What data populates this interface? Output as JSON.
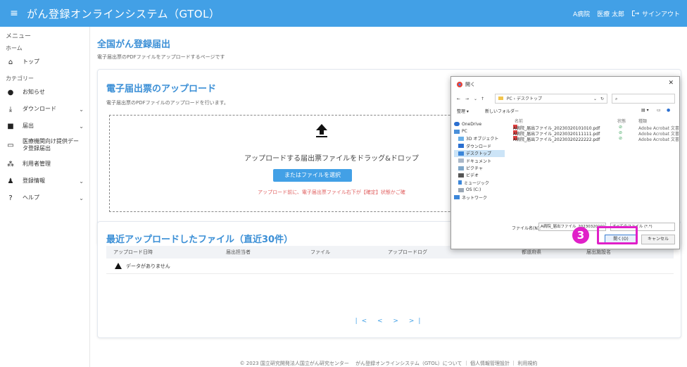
{
  "app": {
    "title": "がん登録オンラインシステム（GTOL）",
    "hospital": "A病院",
    "user": "医療 太郎",
    "signout": "サインアウト"
  },
  "sidebar": {
    "menu_label": "メニュー",
    "home_section": "ホーム",
    "top": "トップ",
    "category_section": "カテゴリー",
    "items": [
      {
        "label": "お知らせ",
        "icon": "info-icon",
        "has_chevron": false
      },
      {
        "label": "ダウンロード",
        "icon": "download-icon",
        "has_chevron": true
      },
      {
        "label": "届出",
        "icon": "file-icon",
        "has_chevron": true
      },
      {
        "label": "医療機関向け提供データ登録届出",
        "icon": "monitor-icon",
        "has_chevron": false
      },
      {
        "label": "利用者管理",
        "icon": "users-icon",
        "has_chevron": false
      },
      {
        "label": "登録情報",
        "icon": "user-settings-icon",
        "has_chevron": true
      },
      {
        "label": "ヘルプ",
        "icon": "help-icon",
        "has_chevron": true
      }
    ]
  },
  "page": {
    "title": "全国がん登録届出",
    "subtitle": "電子届出票のPDFファイルをアップロードするページです"
  },
  "upload": {
    "title": "電子届出票のアップロード",
    "subtitle": "電子届出票のPDFファイルのアップロードを行います。",
    "drop_text": "アップロードする届出票ファイルをドラッグ&ドロップ",
    "pick_button": "またはファイルを選択",
    "warning": "アップロード前に、電子届出票ファイル右下が【確定】状態かご確"
  },
  "recent": {
    "title": "最近アップロードしたファイル（直近30件）",
    "columns": [
      "アップロード日時",
      "届出担当者",
      "ファイル",
      "アップロードログ",
      "都道府県",
      "届出施設名"
    ],
    "empty_message": "データがありません",
    "pager": "|< < > >|"
  },
  "footer": {
    "text": "© 2023 国立研究開発法人国立がん研究センター　 がん登録オンラインシステム（GTOL）について ｜ 個人情報管理設計 ｜ 利用規約"
  },
  "dialog": {
    "title": "開く",
    "address": "PC › デスクトップ",
    "search_placeholder": "",
    "toolbar_organize": "整理 ▾",
    "toolbar_newfolder": "新しいフォルダー",
    "nav_items": [
      "OneDrive",
      "PC",
      "3D オブジェクト",
      "ダウンロード",
      "デスクトップ",
      "ドキュメント",
      "ピクチャ",
      "ビデオ",
      "ミュージック",
      "OS (C:)",
      "ネットワーク"
    ],
    "file_columns": [
      "名前",
      "状態",
      "種類"
    ],
    "files": [
      {
        "name": "A病院_届出ファイル_20230320101010.pdf",
        "type": "Adobe Acrobat 文書"
      },
      {
        "name": "A病院_届出ファイル_20230320111111.pdf",
        "type": "Adobe Acrobat 文書"
      },
      {
        "name": "A病院_届出ファイル_20230320222222.pdf",
        "type": "Adobe Acrobat 文書"
      }
    ],
    "filename_label": "ファイル名(N):",
    "filename_value": "A病院_届出ファイル_20230320101010",
    "filetype_value": "すべてのファイル (*.*)",
    "open_button": "開く(O)",
    "cancel_button": "キャンセル"
  },
  "annotation": {
    "step_number": "3"
  },
  "colors": {
    "brand": "#42a0e6",
    "heading": "#3b8fd6",
    "highlight": "#e020c8",
    "warning": "#e06060"
  }
}
